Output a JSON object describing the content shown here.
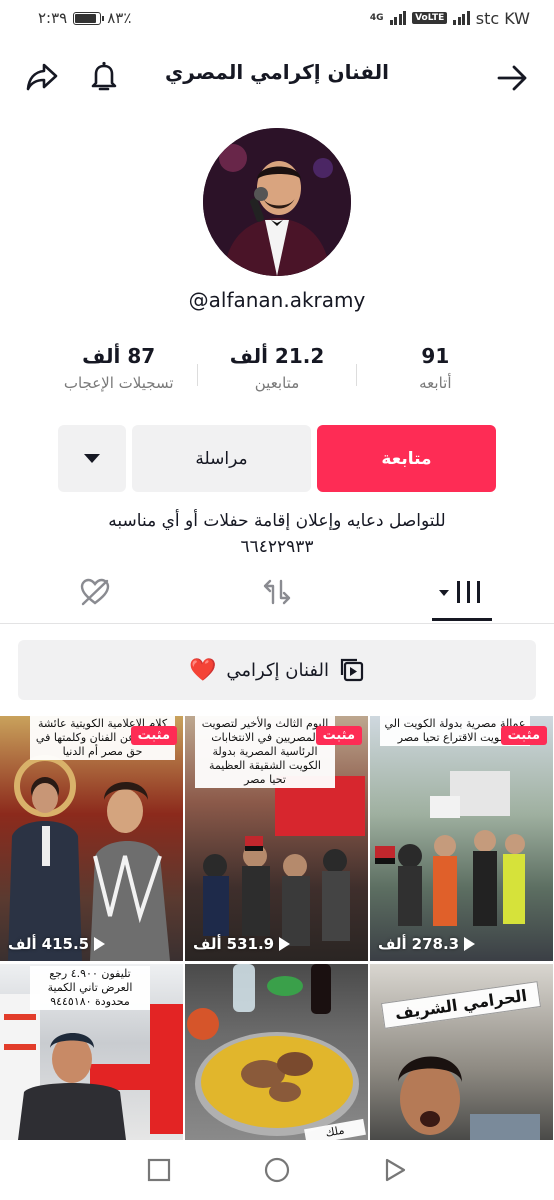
{
  "status": {
    "time": "٢:٣٩",
    "battery": "٨٣٪",
    "network": "4G",
    "volte": "VoLTE",
    "carrier": "stc KW"
  },
  "header": {
    "title": "الفنان إكرامي المصري"
  },
  "profile": {
    "handle": "@alfanan.akramy"
  },
  "stats": [
    {
      "number": "91",
      "label": "أتابعه"
    },
    {
      "number": "21.2 ألف",
      "label": "متابعين"
    },
    {
      "number": "87 ألف",
      "label": "تسجيلات الإعجاب"
    }
  ],
  "actions": {
    "follow": "متابعة",
    "message": "مراسلة"
  },
  "bio": {
    "line1": "للتواصل دعايه وإعلان إقامة حفلات أو أي مناسبه",
    "line2": "٦٦٤٢٢٩٣٣"
  },
  "playlist": {
    "label": "الفنان إكرامي",
    "emoji": "❤️"
  },
  "videos": [
    {
      "pinned": "مثبت",
      "views_num": "278.3",
      "views_unit": "ألف",
      "caption": "عمالة مصرية بدولة الكويت الي تصويت الاقتراع تحيا مصر"
    },
    {
      "pinned": "مثبت",
      "views_num": "531.9",
      "views_unit": "ألف",
      "caption": "اليوم الثالث والأخير لتصويت المصريين في الانتخابات الرئاسية المصرية بدولة الكويت الشقيقة العظيمة تحيا مصر"
    },
    {
      "pinned": "مثبت",
      "views_num": "415.5",
      "views_unit": "ألف",
      "caption": "كلام الإعلامية الكويتية عائشة الرشيد عن الفنان وكلمتها في حق مصر أم الدنيا"
    },
    {
      "caption": "الحرامي الشريف"
    },
    {
      "caption": "ملك"
    },
    {
      "caption": "تليفون ٤.٩٠٠ رجع العرض تاني الكمية محدودة ٩٤٤٥١٨٠"
    }
  ]
}
